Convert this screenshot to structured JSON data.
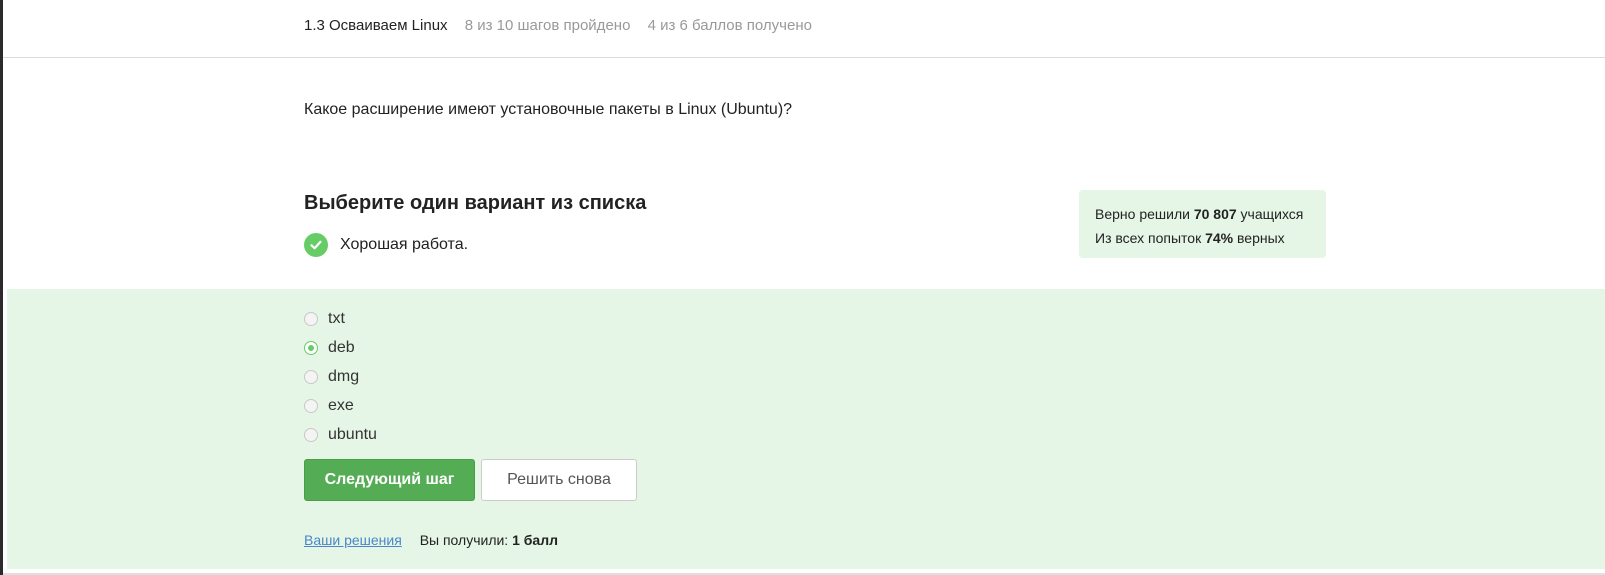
{
  "header": {
    "lesson_title": "1.3 Осваиваем Linux",
    "steps_progress": "8 из 10 шагов пройдено",
    "points_progress": "4 из 6 баллов  получено"
  },
  "question": {
    "text": "Какое расширение имеют установочные пакеты в Linux (Ubuntu)?"
  },
  "quiz": {
    "title": "Выберите один вариант из списка",
    "feedback": "Хорошая работа."
  },
  "stats": {
    "solved_prefix": "Верно решили ",
    "solved_count": "70 807",
    "solved_suffix": " учащихся",
    "attempts_prefix": "Из всех попыток ",
    "attempts_percent": "74%",
    "attempts_suffix": " верных"
  },
  "options": [
    {
      "label": "txt",
      "selected": false
    },
    {
      "label": "deb",
      "selected": true
    },
    {
      "label": "dmg",
      "selected": false
    },
    {
      "label": "exe",
      "selected": false
    },
    {
      "label": "ubuntu",
      "selected": false
    }
  ],
  "buttons": {
    "next_label": "Следующий шаг",
    "retry_label": "Решить снова"
  },
  "footer": {
    "solutions_link": "Ваши решения",
    "score_prefix": "Вы получили: ",
    "score_value": "1 балл"
  },
  "colors": {
    "accent_green": "#66cc66",
    "button_green": "#54ad54",
    "success_bg": "#e6f6e6",
    "link_blue": "#4a86c8"
  }
}
